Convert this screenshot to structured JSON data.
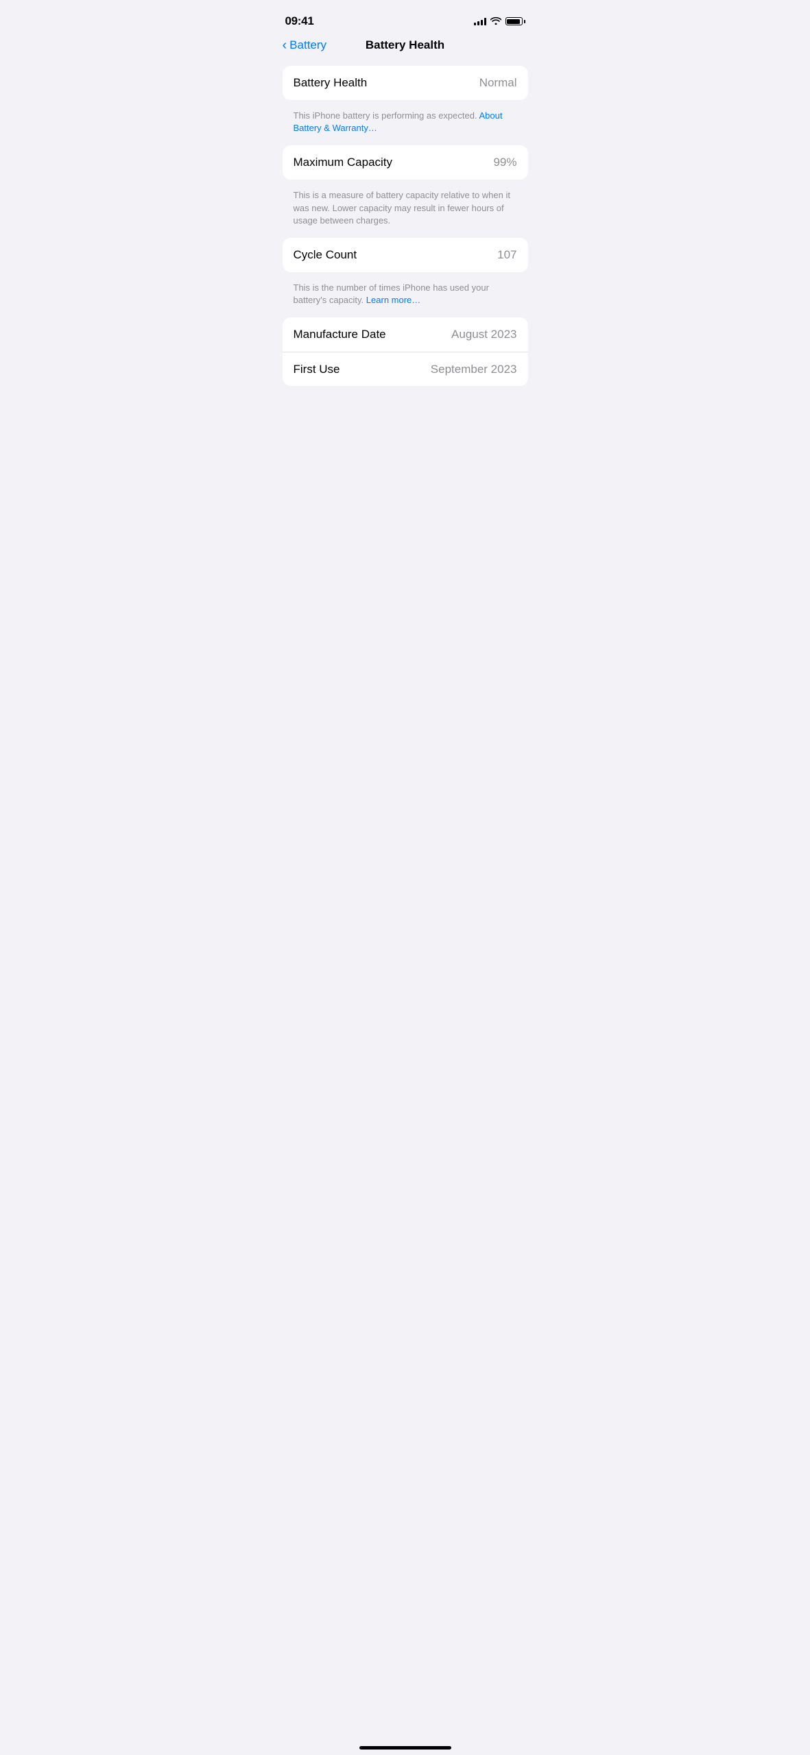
{
  "status_bar": {
    "time": "09:41",
    "signal_bars": [
      4,
      6,
      8,
      10,
      12
    ],
    "battery_level": 95
  },
  "nav": {
    "back_label": "Battery",
    "page_title": "Battery Health"
  },
  "sections": [
    {
      "id": "battery-health-section",
      "rows": [
        {
          "id": "battery-health-row",
          "label": "Battery Health",
          "value": "Normal"
        }
      ],
      "helper": {
        "text_before_link": "This iPhone battery is performing as expected. ",
        "link_text": "About Battery & Warranty…",
        "text_after_link": ""
      }
    },
    {
      "id": "maximum-capacity-section",
      "rows": [
        {
          "id": "maximum-capacity-row",
          "label": "Maximum Capacity",
          "value": "99%"
        }
      ],
      "helper": {
        "text_before_link": "This is a measure of battery capacity relative to when it was new. Lower capacity may result in fewer hours of usage between charges.",
        "link_text": "",
        "text_after_link": ""
      }
    },
    {
      "id": "cycle-count-section",
      "rows": [
        {
          "id": "cycle-count-row",
          "label": "Cycle Count",
          "value": "107"
        }
      ],
      "helper": {
        "text_before_link": "This is the number of times iPhone has used your battery's capacity. ",
        "link_text": "Learn more…",
        "text_after_link": ""
      }
    },
    {
      "id": "dates-section",
      "rows": [
        {
          "id": "manufacture-date-row",
          "label": "Manufacture Date",
          "value": "August 2023"
        },
        {
          "id": "first-use-row",
          "label": "First Use",
          "value": "September 2023"
        }
      ],
      "helper": null
    }
  ],
  "home_indicator": true
}
